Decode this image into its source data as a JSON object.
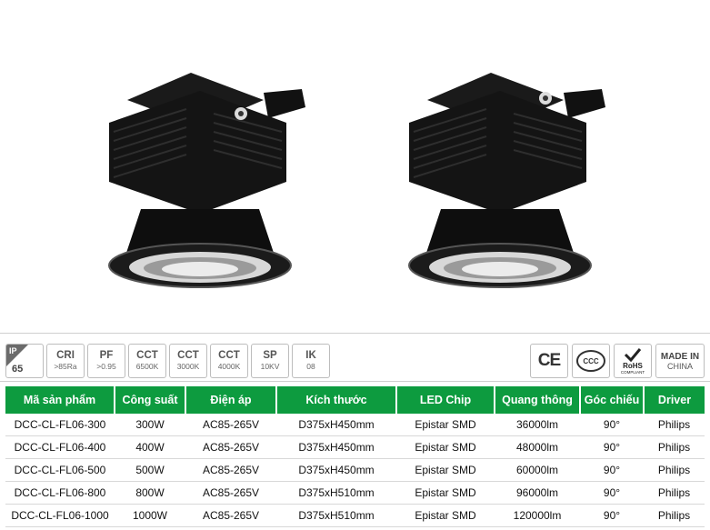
{
  "badges": [
    {
      "title": "CRI",
      "value": ">85Ra"
    },
    {
      "title": "PF",
      "value": ">0.95"
    },
    {
      "title": "CCT",
      "value": "6500K"
    },
    {
      "title": "CCT",
      "value": "3000K"
    },
    {
      "title": "CCT",
      "value": "4000K"
    },
    {
      "title": "SP",
      "value": "10KV"
    },
    {
      "title": "IK",
      "value": "08"
    }
  ],
  "ip": {
    "label": "IP",
    "value": "65"
  },
  "certs": {
    "ce": "CE",
    "ccc": "CCC",
    "rohs": "RoHS",
    "rohs_sub": "COMPLIANT",
    "made_line1": "MADE IN",
    "made_line2": "CHINA"
  },
  "table": {
    "headers": [
      "Mã sản phẩm",
      "Công suất",
      "Điện áp",
      "Kích thước",
      "LED Chip",
      "Quang thông",
      "Góc chiếu",
      "Driver"
    ],
    "rows": [
      [
        "DCC-CL-FL06-300",
        "300W",
        "AC85-265V",
        "D375xH450mm",
        "Epistar SMD",
        "36000lm",
        "90°",
        "Philips"
      ],
      [
        "DCC-CL-FL06-400",
        "400W",
        "AC85-265V",
        "D375xH450mm",
        "Epistar SMD",
        "48000lm",
        "90°",
        "Philips"
      ],
      [
        "DCC-CL-FL06-500",
        "500W",
        "AC85-265V",
        "D375xH450mm",
        "Epistar SMD",
        "60000lm",
        "90°",
        "Philips"
      ],
      [
        "DCC-CL-FL06-800",
        "800W",
        "AC85-265V",
        "D375xH510mm",
        "Epistar SMD",
        "96000lm",
        "90°",
        "Philips"
      ],
      [
        "DCC-CL-FL06-1000",
        "1000W",
        "AC85-265V",
        "D375xH510mm",
        "Epistar SMD",
        "120000lm",
        "90°",
        "Philips"
      ]
    ]
  }
}
